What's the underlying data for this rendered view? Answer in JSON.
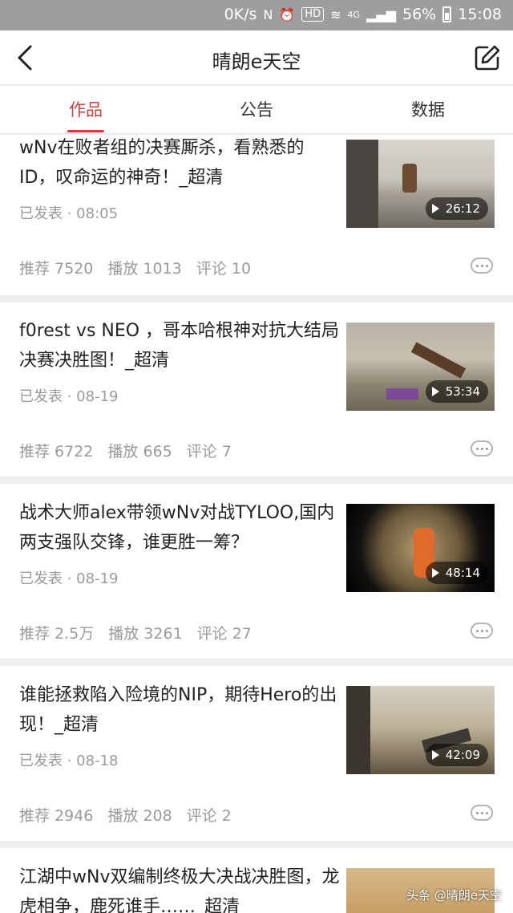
{
  "status_bar": {
    "net_speed": "0K/s",
    "hd": "HD",
    "signal": "4G",
    "battery": "56%",
    "time": "15:08"
  },
  "header": {
    "title": "晴朗e天空"
  },
  "tabs": [
    {
      "label": "作品"
    },
    {
      "label": "公告"
    },
    {
      "label": "数据"
    }
  ],
  "active_tab": "作品",
  "posts": [
    {
      "title": "wNv在败者组的决赛厮杀，看熟悉的ID，叹命运的神奇！_超清",
      "meta": "已发表 · 08:05",
      "duration": "26:12",
      "stats": [
        "推荐 7520",
        "播放 1013",
        "评论 10"
      ]
    },
    {
      "title": "f0rest vs NEO ，哥本哈根神对抗大结局决赛决胜图！_超清",
      "meta": "已发表 · 08-19",
      "duration": "53:34",
      "stats": [
        "推荐 6722",
        "播放 665",
        "评论 7"
      ]
    },
    {
      "title": "战术大师alex带领wNv对战TYLOO,国内两支强队交锋，谁更胜一筹？",
      "meta": "已发表 · 08-19",
      "duration": "48:14",
      "stats": [
        "推荐 2.5万",
        "播放 3261",
        "评论 27"
      ]
    },
    {
      "title": "谁能拯救陷入险境的NIP，期待Hero的出现！_超清",
      "meta": "已发表 · 08-18",
      "duration": "42:09",
      "stats": [
        "推荐 2946",
        "播放 208",
        "评论 2"
      ]
    },
    {
      "title": "江湖中wNv双编制终极大决战决胜图，龙虎相争，鹿死谁手……_超清",
      "meta": "",
      "duration": "",
      "stats": []
    }
  ],
  "watermark": "头条 @晴朗e天空",
  "colors": {
    "accent": "#d43d3d",
    "status_bar": "#9e9e9e"
  }
}
